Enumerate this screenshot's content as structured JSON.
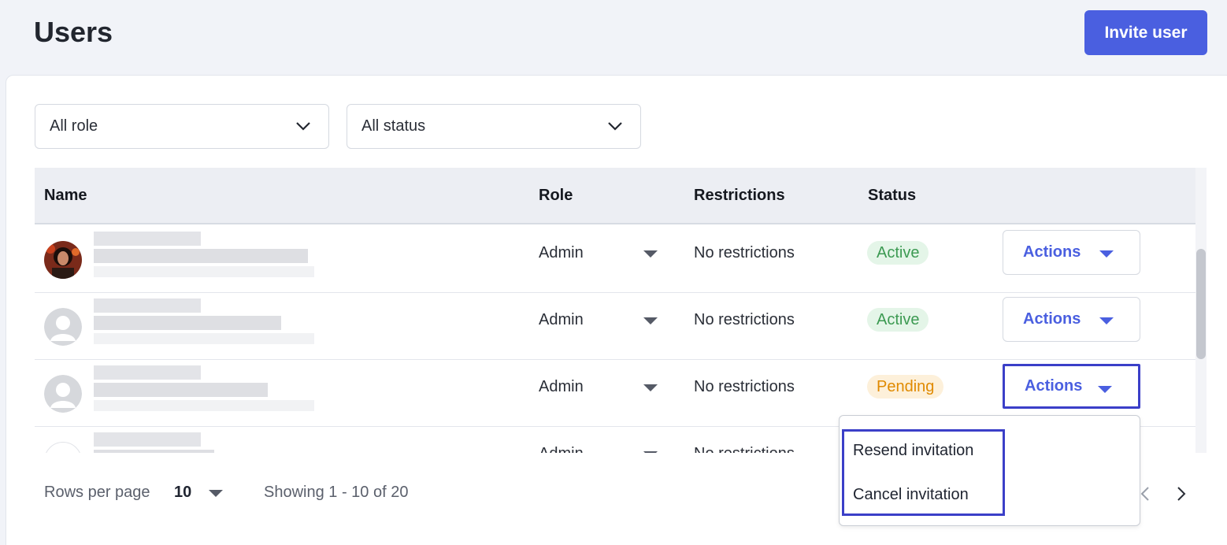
{
  "header": {
    "title": "Users",
    "invite_label": "Invite user"
  },
  "filters": {
    "role": "All role",
    "status": "All status"
  },
  "table": {
    "columns": [
      "Name",
      "Role",
      "Restrictions",
      "Status"
    ],
    "rows": [
      {
        "role": "Admin",
        "restrictions": "No restrictions",
        "status": "Active",
        "action": "Actions"
      },
      {
        "role": "Admin",
        "restrictions": "No restrictions",
        "status": "Active",
        "action": "Actions"
      },
      {
        "role": "Admin",
        "restrictions": "No restrictions",
        "status": "Pending",
        "action": "Actions"
      },
      {
        "role": "Admin",
        "restrictions": "No restrictions",
        "status": "",
        "action": ""
      }
    ]
  },
  "footer": {
    "rows_per_page_label": "Rows per page",
    "rows_per_page_value": "10",
    "showing": "Showing 1 - 10 of 20"
  },
  "dropdown": {
    "items": [
      "Resend invitation",
      "Cancel invitation"
    ]
  },
  "colors": {
    "accent": "#4a5fe0",
    "active_text": "#3c9a52",
    "pending_text": "#e08a00",
    "highlight": "#3b3fc8"
  }
}
